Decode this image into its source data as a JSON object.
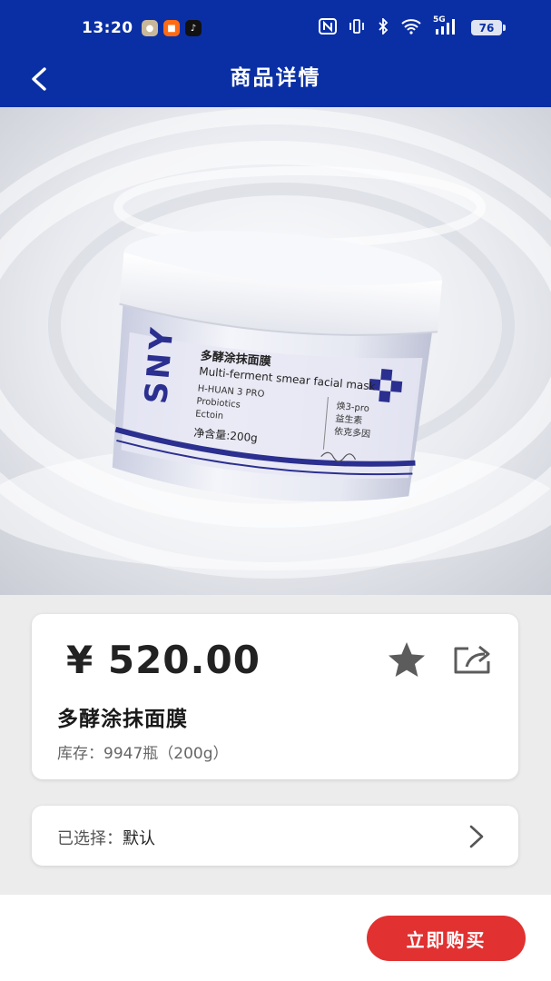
{
  "status_bar": {
    "time": "13:20",
    "battery": "76",
    "signal_label": "5G"
  },
  "nav": {
    "title": "商品详情"
  },
  "product_image": {
    "brand": "SNY",
    "name_cn": "多酵涂抹面膜",
    "name_en": "Multi-ferment smear facial mask",
    "bullets": [
      "H-HUAN 3 PRO",
      "Probiotics",
      "Ectoin"
    ],
    "right_labels": [
      "焕3-pro",
      "益生素",
      "依克多因"
    ],
    "net_content": "净含量:200g"
  },
  "product": {
    "price": "¥ 520.00",
    "name": "多酵涂抹面膜",
    "stock": "库存：9947瓶（200g）"
  },
  "selection": {
    "label": "已选择：",
    "value": "默认"
  },
  "actions": {
    "buy": "立即购买"
  },
  "colors": {
    "brand_blue": "#0a2fa5",
    "buy_red": "#e13131",
    "jar_accent": "#2b2f8f"
  }
}
